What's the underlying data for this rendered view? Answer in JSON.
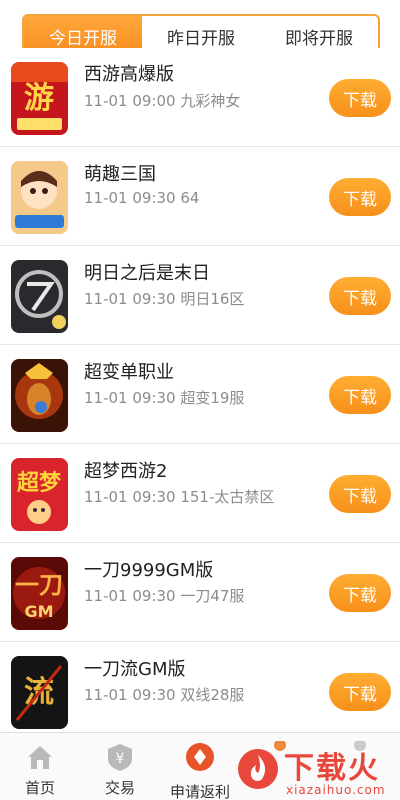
{
  "tabs": [
    {
      "label": "今日开服",
      "active": true
    },
    {
      "label": "昨日开服",
      "active": false
    },
    {
      "label": "即将开服",
      "active": false
    }
  ],
  "games": [
    {
      "name": "西游高爆版",
      "meta": "11-01 09:00 九彩神女",
      "button": "下载",
      "icon": "xiyou-game-icon"
    },
    {
      "name": "萌趣三国",
      "meta": "11-01 09:30 64",
      "button": "下载",
      "icon": "mengqu-game-icon"
    },
    {
      "name": "明日之后是末日",
      "meta": "11-01 09:30 明日16区",
      "button": "下载",
      "icon": "mingri-game-icon"
    },
    {
      "name": "超变单职业",
      "meta": "11-01 09:30 超变19服",
      "button": "下载",
      "icon": "chaobian-game-icon"
    },
    {
      "name": "超梦西游2",
      "meta": "11-01 09:30 151-太古禁区",
      "button": "下载",
      "icon": "chaomeng-game-icon"
    },
    {
      "name": "一刀9999GM版",
      "meta": "11-01 09:30 一刀47服",
      "button": "下载",
      "icon": "yidao-game-icon"
    },
    {
      "name": "一刀流GM版",
      "meta": "11-01 09:30 双线28服",
      "button": "下载",
      "icon": "yidaoliu-game-icon"
    }
  ],
  "tabbar": [
    {
      "label": "首页",
      "icon": "home-icon"
    },
    {
      "label": "交易",
      "icon": "trade-icon"
    },
    {
      "label": "申请返利",
      "icon": "rebate-icon"
    }
  ],
  "watermark": {
    "text": "下载火",
    "url": "xiazaihuo.com"
  },
  "colors": {
    "accent": "#f7901a",
    "watermark": "#e8483b"
  }
}
